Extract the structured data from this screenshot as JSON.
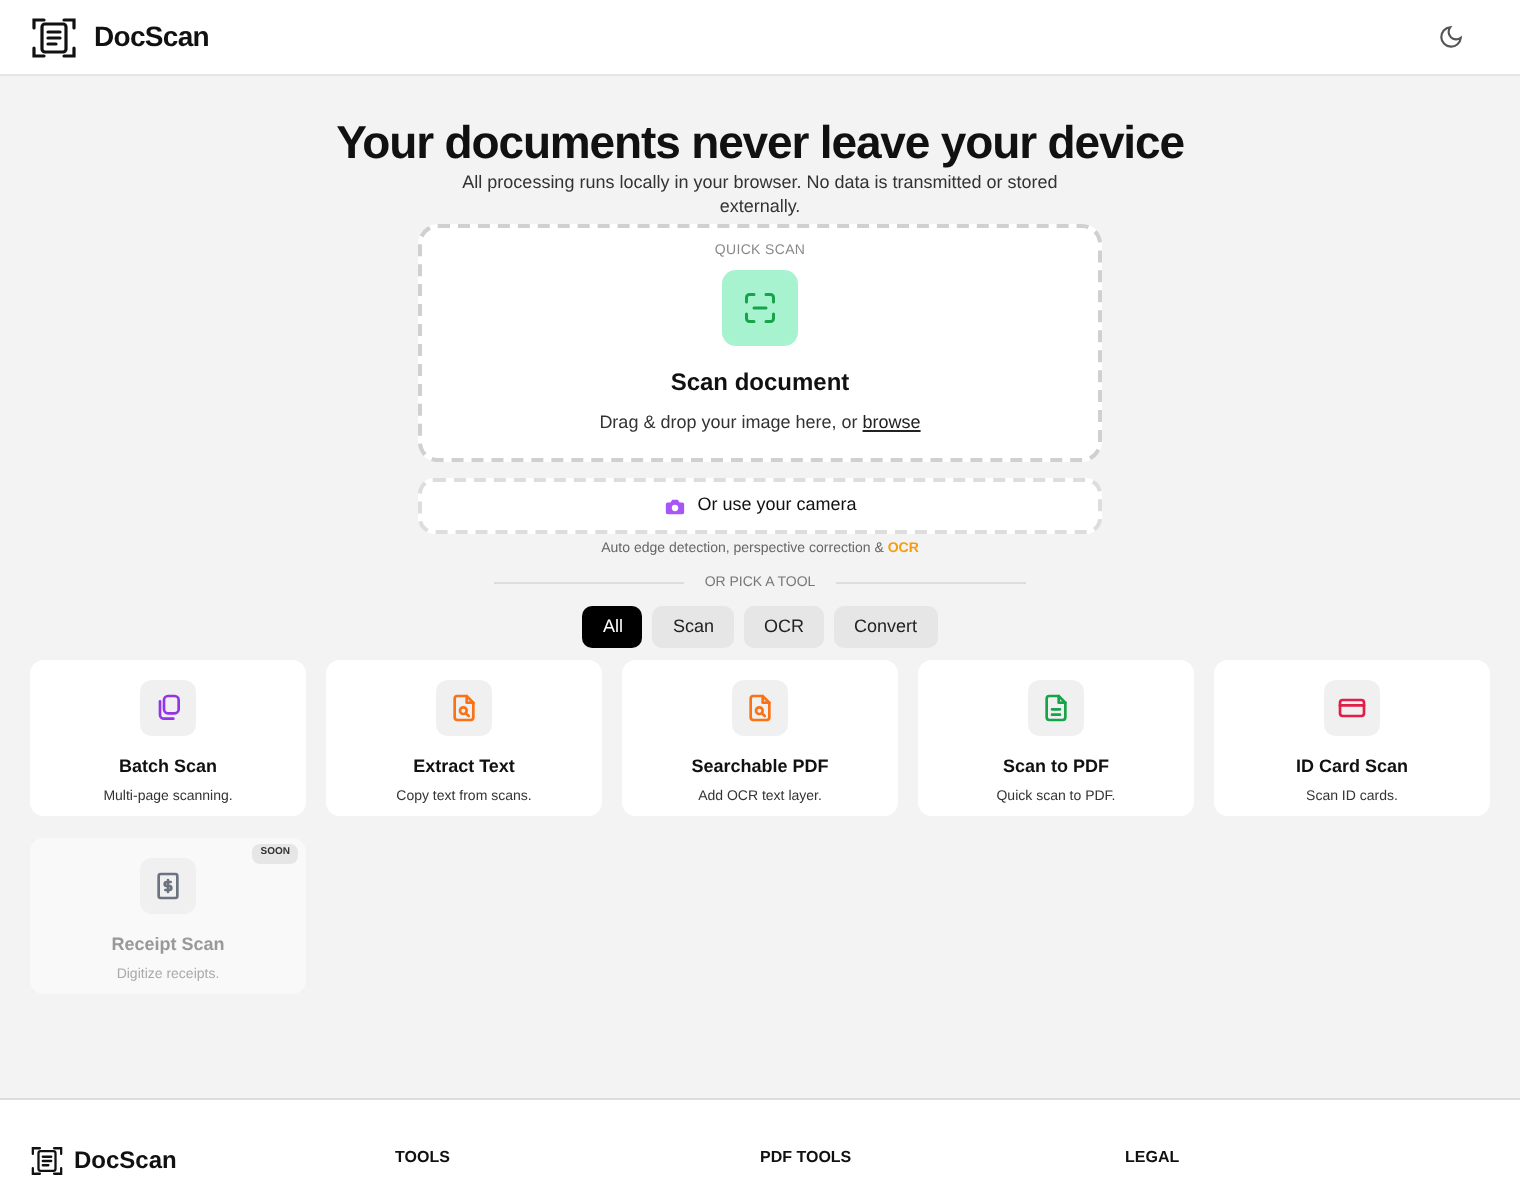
{
  "header": {
    "brand": "DocScan"
  },
  "hero": {
    "title": "Your documents never leave your device",
    "subtitle": "All processing runs locally in your browser. No data is transmitted or stored externally."
  },
  "quick_scan": {
    "label": "QUICK SCAN",
    "title": "Scan document",
    "hint": "Drag & drop your image here, or",
    "link": "browse"
  },
  "camera": {
    "label": "Or use your camera"
  },
  "features": {
    "text": "Auto edge detection, perspective correction &",
    "highlight": "OCR"
  },
  "divider": "OR PICK A TOOL",
  "tabs": [
    {
      "label": "All",
      "selected": true
    },
    {
      "label": "Scan",
      "selected": false
    },
    {
      "label": "OCR",
      "selected": false
    },
    {
      "label": "Convert",
      "selected": false
    }
  ],
  "tools": [
    {
      "kind": "pages",
      "title": "Batch Scan",
      "desc": "Multi-page scanning.",
      "color": "#9333ea",
      "disabled": false
    },
    {
      "kind": "search-file",
      "title": "Extract Text",
      "desc": "Copy text from scans.",
      "color": "#f97316",
      "disabled": false
    },
    {
      "kind": "search-file",
      "title": "Searchable PDF",
      "desc": "Add OCR text layer.",
      "color": "#f97316",
      "disabled": false
    },
    {
      "kind": "text-file",
      "title": "Scan to PDF",
      "desc": "Quick scan to PDF.",
      "color": "#16a34a",
      "disabled": false
    },
    {
      "kind": "card",
      "title": "ID Card Scan",
      "desc": "Scan ID cards.",
      "color": "#e11d48",
      "disabled": false
    },
    {
      "kind": "receipt",
      "title": "Receipt Scan",
      "desc": "Digitize receipts.",
      "color": "#6b7280",
      "disabled": true,
      "badge": "SOON"
    }
  ],
  "footer": {
    "brand": "DocScan",
    "columns": [
      "TOOLS",
      "PDF TOOLS",
      "LEGAL"
    ]
  }
}
